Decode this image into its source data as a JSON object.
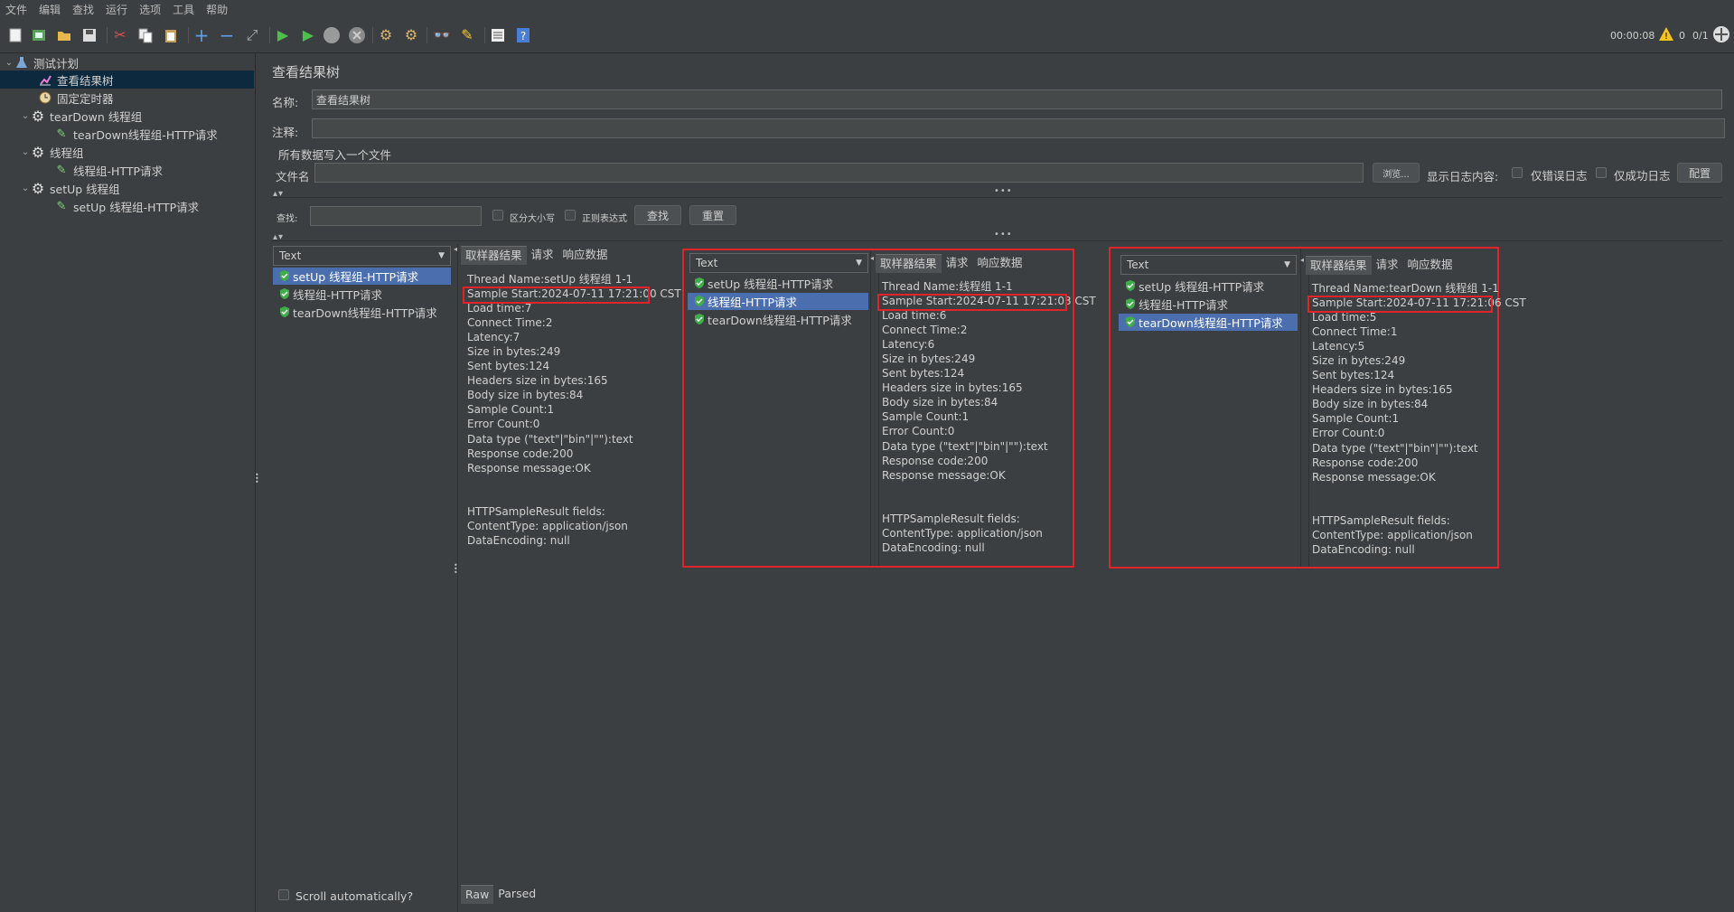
{
  "menu": [
    "文件",
    "编辑",
    "查找",
    "运行",
    "选项",
    "工具",
    "帮助"
  ],
  "toolbar_icons": [
    "new-icon",
    "templates-icon",
    "open-icon",
    "save-icon",
    "cut-icon",
    "copy-icon",
    "paste-icon",
    "expand-icon",
    "collapse-icon",
    "toggle-icon",
    "start-icon",
    "start-no-pause-icon",
    "stop-icon",
    "shutdown-icon",
    "clear-icon",
    "clear-all-icon",
    "search-icon",
    "reset-search-icon",
    "function-helper-icon",
    "help-icon"
  ],
  "status": {
    "timer": "00:00:08",
    "warnings": "0",
    "threads": "0/1"
  },
  "tree": {
    "items": [
      {
        "label": "测试计划",
        "icon": "flask-icon"
      },
      {
        "label": "查看结果树",
        "icon": "chart-icon"
      },
      {
        "label": "固定定时器",
        "icon": "timer-icon"
      },
      {
        "label": "tearDown 线程组",
        "icon": "gear-icon"
      },
      {
        "label": "tearDown线程组-HTTP请求",
        "icon": "pipette-icon"
      },
      {
        "label": "线程组",
        "icon": "gear-icon"
      },
      {
        "label": "线程组-HTTP请求",
        "icon": "pipette-icon"
      },
      {
        "label": "setUp 线程组",
        "icon": "gear-icon"
      },
      {
        "label": "setUp 线程组-HTTP请求",
        "icon": "pipette-icon"
      }
    ]
  },
  "panel": {
    "title": "查看结果树",
    "name_label": "名称:",
    "name_value": "查看结果树",
    "comment_label": "注释:",
    "comment_value": "",
    "file_section": "所有数据写入一个文件",
    "filename_label": "文件名",
    "browse_label": "浏览...",
    "log_label": "显示日志内容:",
    "errors_only": "仅错误日志",
    "success_only": "仅成功日志",
    "configure": "配置",
    "search_label": "查找:",
    "case_sensitive": "区分大小写",
    "regex": "正则表达式",
    "find_button": "查找",
    "reset_button": "重置",
    "scroll_auto": "Scroll automatically?",
    "raw_tab": "Raw",
    "parsed_tab": "Parsed"
  },
  "result_panes": [
    {
      "renderer": "Text",
      "samples": [
        "setUp 线程组-HTTP请求",
        "线程组-HTTP请求",
        "tearDown线程组-HTTP请求"
      ],
      "selected": 0,
      "tabs": [
        "取样器结果",
        "请求",
        "响应数据"
      ],
      "details": [
        "Thread Name:setUp 线程组 1-1",
        "Sample Start:2024-07-11 17:21:00 CST",
        "Load time:7",
        "Connect Time:2",
        "Latency:7",
        "Size in bytes:249",
        "Sent bytes:124",
        "Headers size in bytes:165",
        "Body size in bytes:84",
        "Sample Count:1",
        "Error Count:0",
        "Data type (\"text\"|\"bin\"|\"\"):text",
        "Response code:200",
        "Response message:OK",
        "",
        "",
        "HTTPSampleResult fields:",
        "ContentType: application/json",
        "DataEncoding: null"
      ]
    },
    {
      "renderer": "Text",
      "samples": [
        "setUp 线程组-HTTP请求",
        "线程组-HTTP请求",
        "tearDown线程组-HTTP请求"
      ],
      "selected": 1,
      "tabs": [
        "取样器结果",
        "请求",
        "响应数据"
      ],
      "details": [
        "Thread Name:线程组 1-1",
        "Sample Start:2024-07-11 17:21:03 CST",
        "Load time:6",
        "Connect Time:2",
        "Latency:6",
        "Size in bytes:249",
        "Sent bytes:124",
        "Headers size in bytes:165",
        "Body size in bytes:84",
        "Sample Count:1",
        "Error Count:0",
        "Data type (\"text\"|\"bin\"|\"\"):text",
        "Response code:200",
        "Response message:OK",
        "",
        "",
        "HTTPSampleResult fields:",
        "ContentType: application/json",
        "DataEncoding: null"
      ]
    },
    {
      "renderer": "Text",
      "samples": [
        "setUp 线程组-HTTP请求",
        "线程组-HTTP请求",
        "tearDown线程组-HTTP请求"
      ],
      "selected": 2,
      "tabs": [
        "取样器结果",
        "请求",
        "响应数据"
      ],
      "details": [
        "Thread Name:tearDown 线程组 1-1",
        "Sample Start:2024-07-11 17:21:06 CST",
        "Load time:5",
        "Connect Time:1",
        "Latency:5",
        "Size in bytes:249",
        "Sent bytes:124",
        "Headers size in bytes:165",
        "Body size in bytes:84",
        "Sample Count:1",
        "Error Count:0",
        "Data type (\"text\"|\"bin\"|\"\"):text",
        "Response code:200",
        "Response message:OK",
        "",
        "",
        "HTTPSampleResult fields:",
        "ContentType: application/json",
        "DataEncoding: null"
      ]
    }
  ],
  "colors": {
    "background": "#3c3f41",
    "selection": "#4b6eaf",
    "highlight_box": "#e0242a",
    "ok_icon": "#3fae49"
  }
}
